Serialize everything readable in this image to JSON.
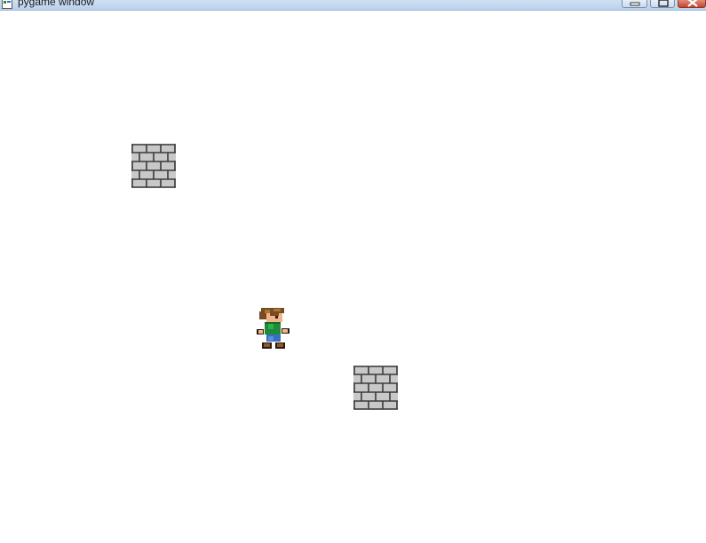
{
  "window": {
    "title": "pygame window",
    "icon": "pygame-app-icon",
    "controls": [
      "minimize-icon",
      "maximize-icon",
      "close-icon"
    ]
  },
  "game": {
    "background_color": "#ffffff",
    "sprites": [
      {
        "type": "wall",
        "icon": "brick-wall-icon"
      },
      {
        "type": "wall",
        "icon": "brick-wall-icon"
      },
      {
        "type": "player",
        "icon": "player-character-icon"
      }
    ]
  }
}
